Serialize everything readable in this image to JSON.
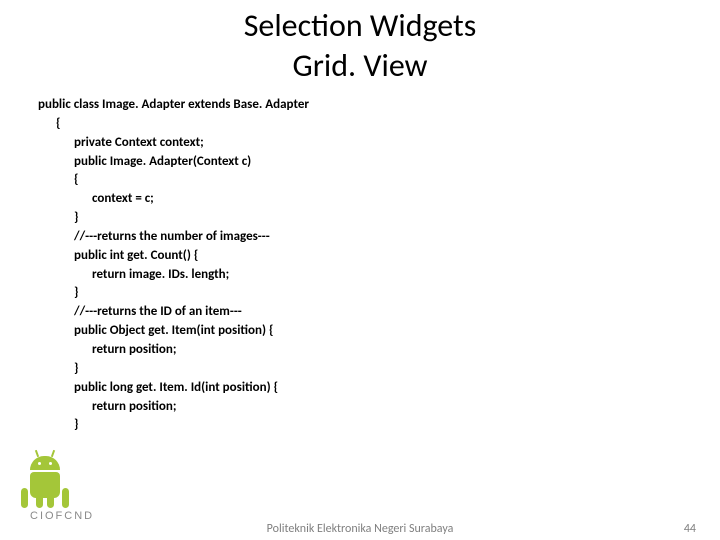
{
  "title": {
    "line1": "Selection Widgets",
    "line2": "Grid. View"
  },
  "code": {
    "l01": "public class Image. Adapter extends Base. Adapter",
    "l02": "{",
    "l03": "private Context context;",
    "l04": "public Image. Adapter(Context c)",
    "l05": "{",
    "l06": "context = c;",
    "l07": "}",
    "l08": "//---returns the number of images---",
    "l09": "public int get. Count() {",
    "l10": "return image. IDs. length;",
    "l11": "}",
    "l12": "//---returns the ID of an item---",
    "l13": "public Object get. Item(int position) {",
    "l14": "return position;",
    "l15": "}",
    "l16": "public long get. Item. Id(int position) {",
    "l17": "return position;",
    "l18": "}"
  },
  "footer": {
    "center": "Politeknik Elektronika Negeri Surabaya",
    "page": "44"
  },
  "logo": {
    "wordmark": "CIOFCND"
  }
}
